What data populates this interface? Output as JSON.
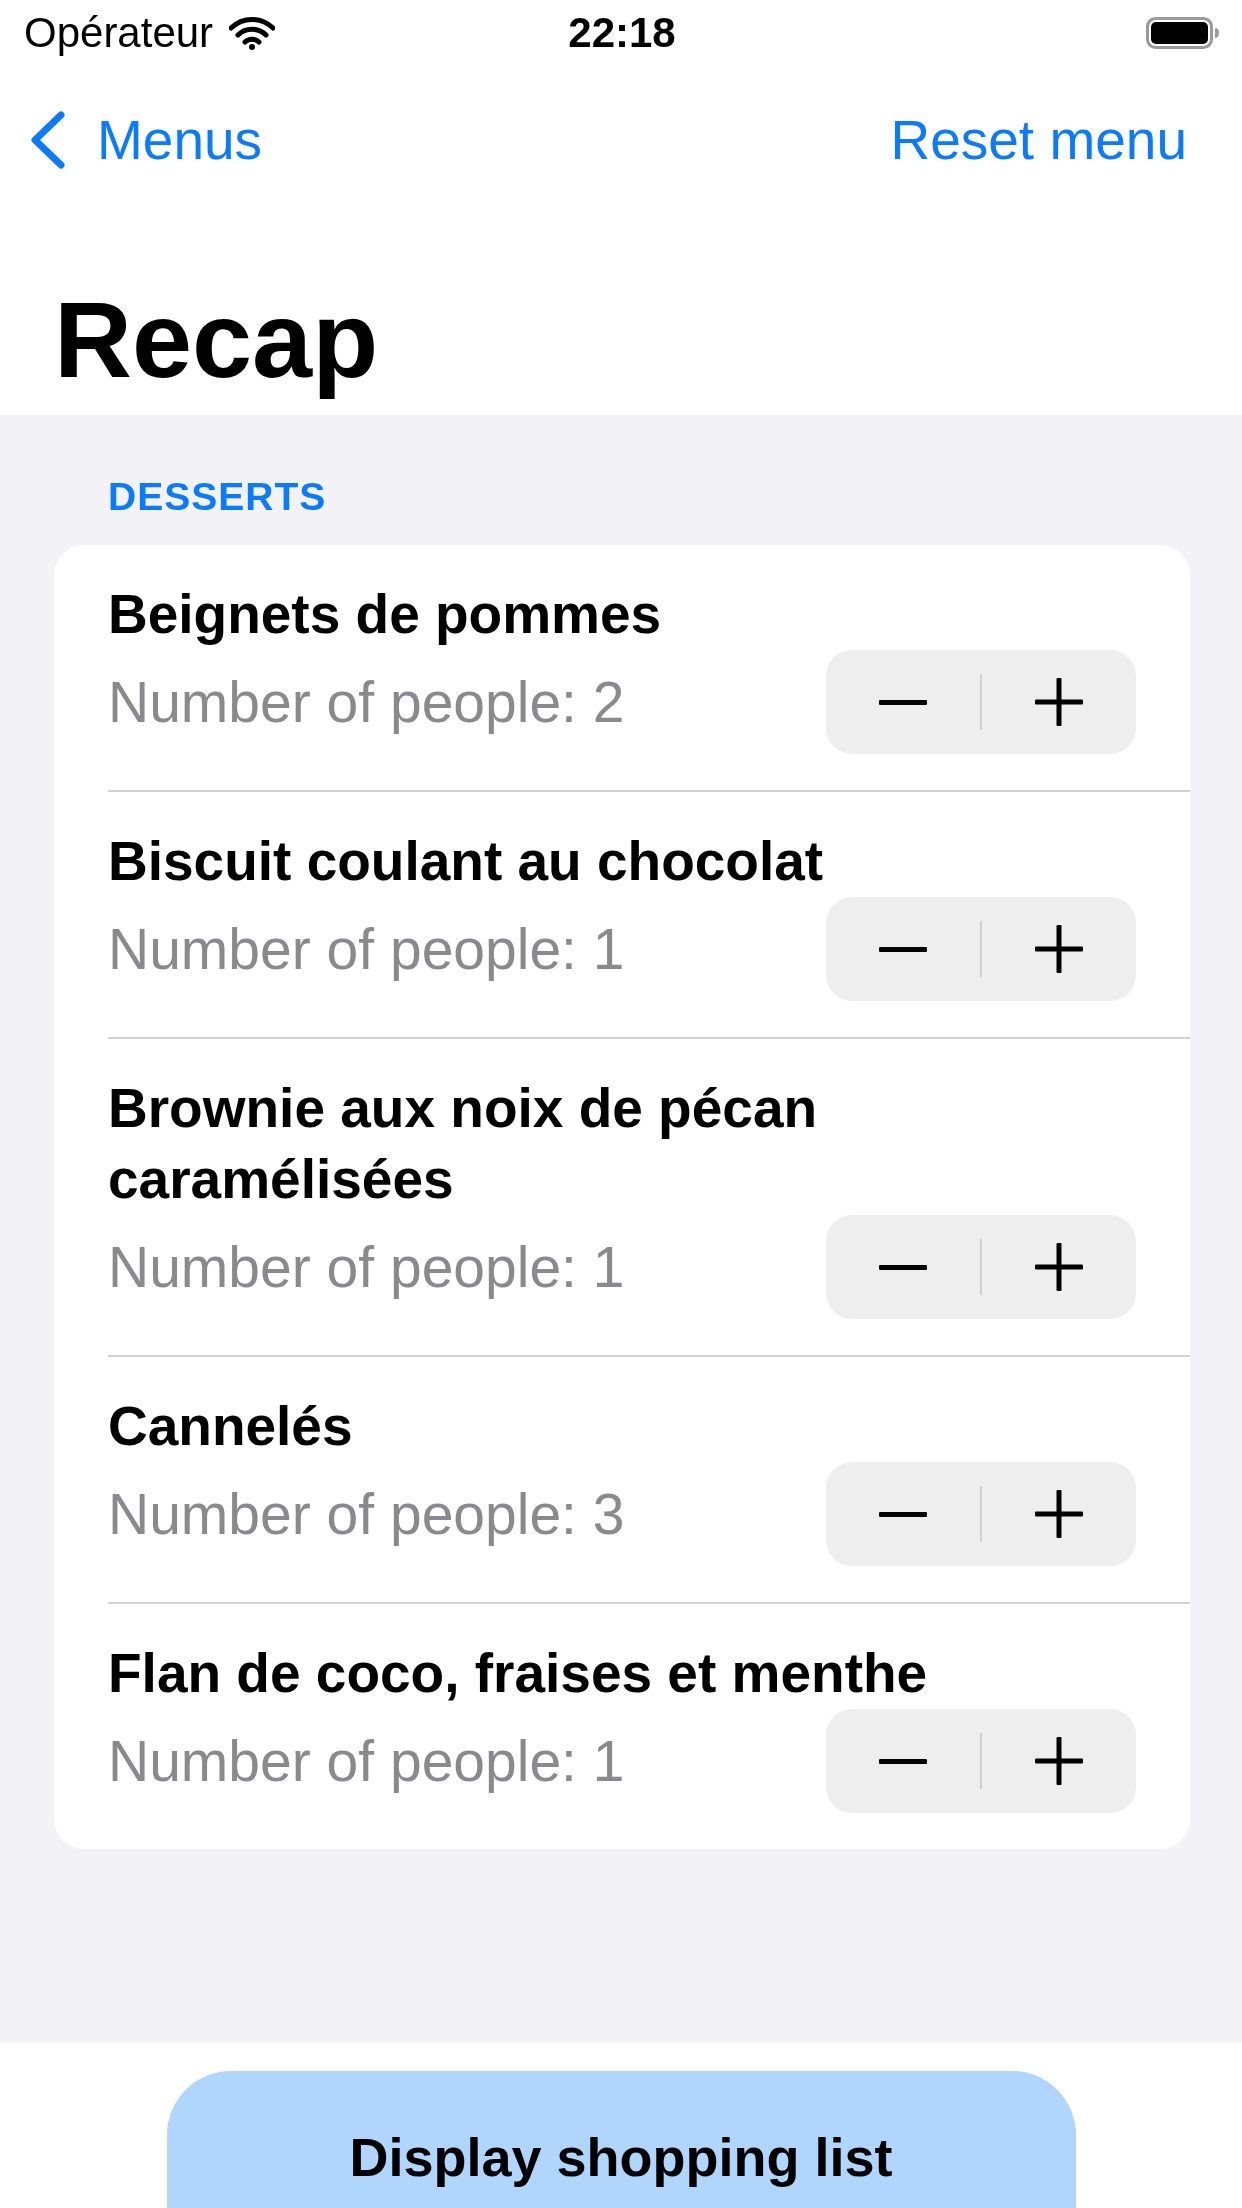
{
  "status_bar": {
    "carrier": "Opérateur",
    "time": "22:18"
  },
  "nav_bar": {
    "back_label": "Menus",
    "action_label": "Reset menu"
  },
  "title": "Recap",
  "section": {
    "header": "DESSERTS",
    "items": [
      {
        "name": "Beignets de pommes",
        "people_label": "Number of people: 2"
      },
      {
        "name": "Biscuit coulant au chocolat",
        "people_label": "Number of people: 1"
      },
      {
        "name": "Brownie aux noix de pécan caramélisées",
        "people_label": "Number of people: 1"
      },
      {
        "name": "Cannelés",
        "people_label": "Number of people: 3"
      },
      {
        "name": "Flan de coco, fraises et menthe",
        "people_label": "Number of people: 1"
      }
    ]
  },
  "primary_button": {
    "label": "Display shopping list"
  }
}
